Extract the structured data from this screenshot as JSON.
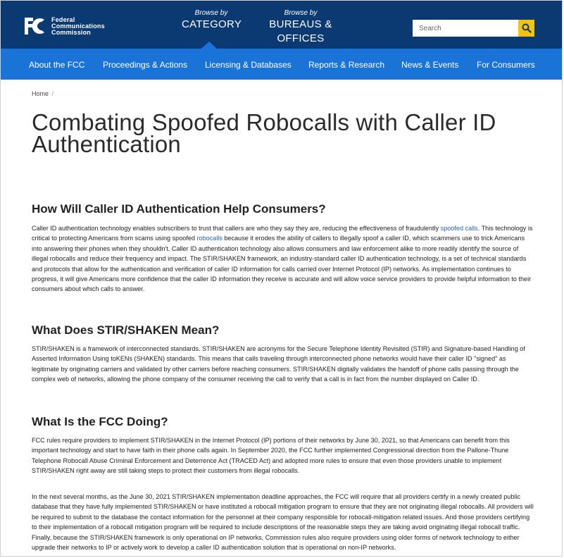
{
  "header": {
    "logo_lines": [
      "Federal",
      "Communications",
      "Commission"
    ],
    "browse_category": {
      "small": "Browse by",
      "big": "CATEGORY"
    },
    "browse_bureaus": {
      "small": "Browse by",
      "big": "BUREAUS & OFFICES"
    },
    "search": {
      "placeholder": "Search"
    }
  },
  "nav": {
    "items": [
      "About the FCC",
      "Proceedings & Actions",
      "Licensing & Databases",
      "Reports & Research",
      "News & Events",
      "For Consumers"
    ]
  },
  "breadcrumb": {
    "home": "Home",
    "separator": "/"
  },
  "page": {
    "title": "Combating Spoofed Robocalls with Caller ID Authentication"
  },
  "sections": [
    {
      "heading": "How Will Caller ID Authentication Help Consumers?",
      "p1_a": "Caller ID authentication technology enables subscribers to trust that callers are who they say they are, reducing the effectiveness of fraudulently ",
      "p1_link1": "spoofed calls",
      "p1_b": ". This technology is critical to protecting Americans from scams using spoofed ",
      "p1_link2": "robocalls",
      "p1_c": " because it erodes the ability of callers to illegally spoof a caller ID, which scammers use to trick Americans into answering their phones when they shouldn't. Caller ID authentication technology also allows consumers and law enforcement alike to more readily identify the source of illegal robocalls and reduce their frequency and impact. The STIR/SHAKEN framework, an industry-standard caller ID authentication technology, is a set of technical standards and protocols that allow for the authentication and verification of caller ID information for calls carried over Internet Protocol (IP) networks. As implementation continues to progress, it will give Americans more confidence that the caller ID information they receive is accurate and will allow voice service providers to provide helpful information to their consumers about which calls to answer."
    },
    {
      "heading": "What Does STIR/SHAKEN Mean?",
      "p1": "STIR/SHAKEN is a framework of interconnected standards. STIR/SHAKEN are acronyms for the Secure Telephone Identity Revisited (STIR) and Signature-based Handling of Asserted Information Using toKENs (SHAKEN) standards. This means that calls traveling through interconnected phone networks would have their caller ID \"signed\" as legitimate by originating carriers and validated by other carriers before reaching consumers. STIR/SHAKEN digitally validates the handoff of phone calls passing through the complex web of networks, allowing the phone company of the consumer receiving the call to verify that a call is in fact from the number displayed on Caller ID."
    },
    {
      "heading": "What Is the FCC Doing?",
      "p1": "FCC rules require providers to implement STIR/SHAKEN in the Internet Protocol (IP) portions of their networks by June 30, 2021, so that Americans can benefit from this important technology and start to have faith in their phone calls again. In September 2020, the FCC further implemented Congressional direction from the Pallone-Thune Telephone Robocall Abuse Criminal Enforcement and Deterrence Act (TRACED Act) and adopted more rules to ensure that even those providers unable to implement STIR/SHAKEN right away are still taking steps to protect their customers from illegal robocalls.",
      "p2": "In the next several months, as the June 30, 2021 STIR/SHAKEN implementation deadline approaches, the FCC will require that all providers certify in a newly created public database that they have fully implemented STIR/SHAKEN or have instituted a robocall mitigation program to ensure that they are not originating illegal robocalls. All providers will be required to submit to the database the contact information for the personnel at their company responsible for robocall-mitigation related issues. And those providers certifying to their implementation of a robocall mitigation program will be required to include descriptions of the reasonable steps they are taking avoid originating illegal robocall traffic. Finally, because the STIR/SHAKEN framework is only operational on IP networks, Commission rules also require providers using older forms of network technology to either upgrade their networks to IP or actively work to develop a caller ID authentication solution that is operational on non-IP networks."
    }
  ],
  "colors": {
    "topbar": "#0b3a73",
    "nav": "#1a73d6",
    "search_button": "#f2c40c",
    "link": "#2a62b8"
  }
}
